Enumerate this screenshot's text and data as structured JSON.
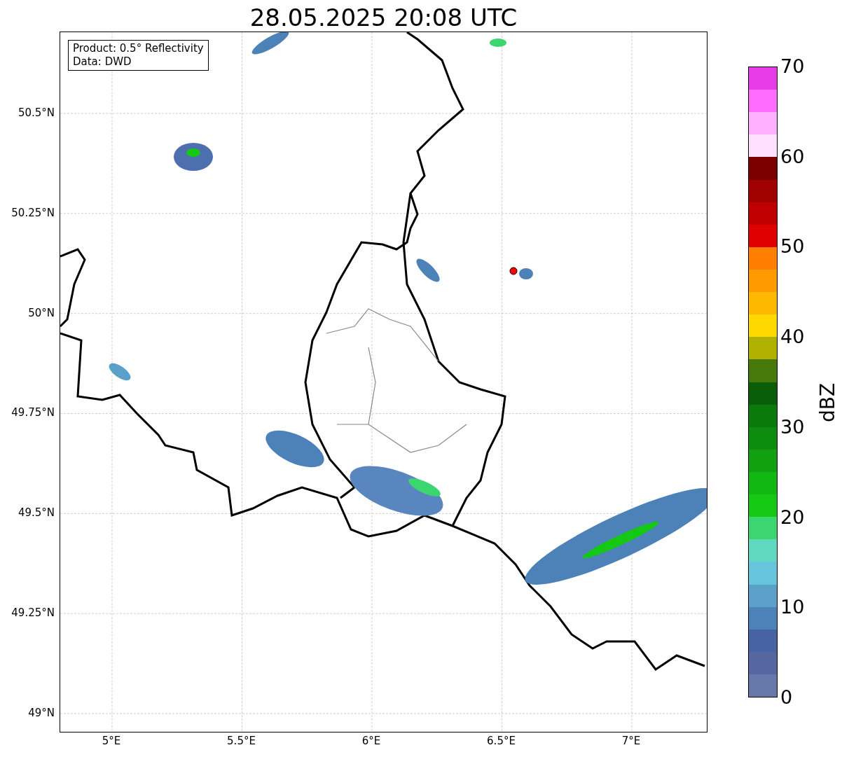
{
  "title": "28.05.2025 20:08 UTC",
  "info_box": [
    "Product: 0.5° Reflectivity",
    "Data: DWD"
  ],
  "y_ticks": [
    "50.5°N",
    "50.25°N",
    "50°N",
    "49.75°N",
    "49.5°N",
    "49.25°N",
    "49°N"
  ],
  "x_ticks": [
    "5°E",
    "5.5°E",
    "6°E",
    "6.5°E",
    "7°E"
  ],
  "colorbar": {
    "label": "dBZ",
    "ticks": [
      "70",
      "60",
      "50",
      "40",
      "30",
      "20",
      "10",
      "0"
    ],
    "segments": [
      {
        "color": "#e83ce8"
      },
      {
        "color": "#ff6aff"
      },
      {
        "color": "#ffb0ff"
      },
      {
        "color": "#ffe0ff"
      },
      {
        "color": "#7a0000"
      },
      {
        "color": "#a00000"
      },
      {
        "color": "#c00000"
      },
      {
        "color": "#e00000"
      },
      {
        "color": "#ff8000"
      },
      {
        "color": "#ff9a00"
      },
      {
        "color": "#ffb800"
      },
      {
        "color": "#ffd800"
      },
      {
        "color": "#b0b000"
      },
      {
        "color": "#457a0a"
      },
      {
        "color": "#0a5e0a"
      },
      {
        "color": "#0a7a0a"
      },
      {
        "color": "#0e8c0e"
      },
      {
        "color": "#10a010"
      },
      {
        "color": "#12b812"
      },
      {
        "color": "#14c814"
      },
      {
        "color": "#3cd670"
      },
      {
        "color": "#60d8c0"
      },
      {
        "color": "#66c4dc"
      },
      {
        "color": "#5aa0c8"
      },
      {
        "color": "#4d82b8"
      },
      {
        "color": "#4862a6"
      },
      {
        "color": "#5566a0"
      },
      {
        "color": "#6677aa"
      }
    ]
  }
}
